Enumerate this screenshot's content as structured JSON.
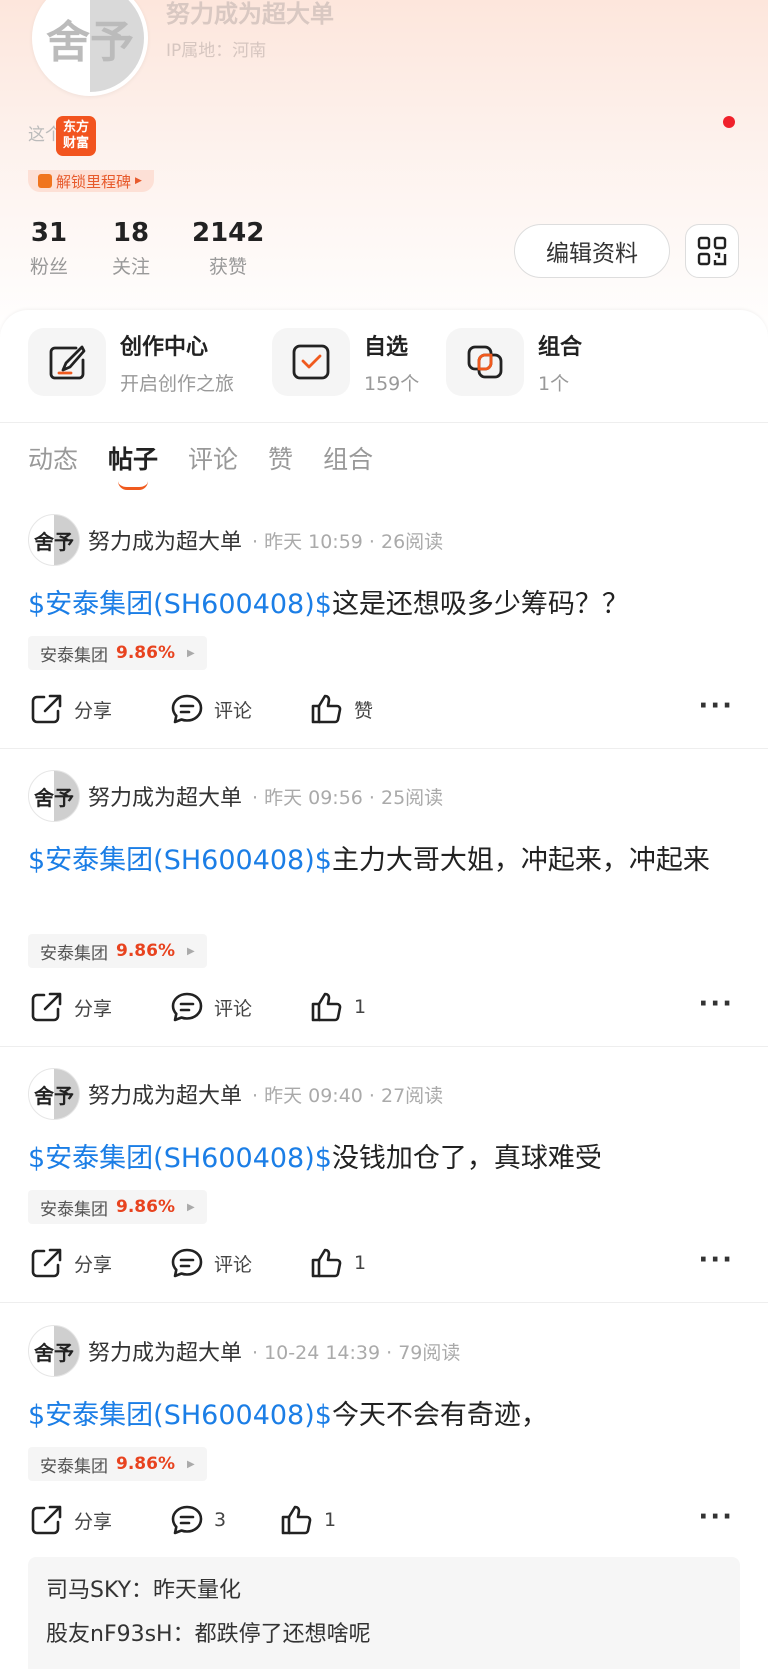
{
  "profile": {
    "avatar_text": "舍予",
    "name": "努力成为超大单",
    "ip_label": "IP属地：河南",
    "bio_prefix": "这个",
    "app_badge": "东方财富",
    "milestone": "解锁里程碑",
    "stats": [
      {
        "num": "31",
        "label": "粉丝"
      },
      {
        "num": "18",
        "label": "关注"
      },
      {
        "num": "2142",
        "label": "获赞"
      }
    ],
    "edit_button": "编辑资料"
  },
  "quick": [
    {
      "title": "创作中心",
      "sub": "开启创作之旅",
      "icon": "edit-icon"
    },
    {
      "title": "自选",
      "sub": "159个",
      "icon": "check-icon"
    },
    {
      "title": "组合",
      "sub": "1个",
      "icon": "combine-icon"
    }
  ],
  "tabs": [
    "动态",
    "帖子",
    "评论",
    "赞",
    "组合"
  ],
  "active_tab": "帖子",
  "posts": [
    {
      "avatar": "舍予",
      "name": "努力成为超大单",
      "time": "· 昨天 10:59 · 26阅读",
      "stock": "$安泰集团(SH600408)$",
      "text": "这是还想吸多少筹码？？",
      "tag_name": "安泰集团",
      "tag_pct": "9.86%",
      "share": "分享",
      "comment": "评论",
      "like": "赞"
    },
    {
      "avatar": "舍予",
      "name": "努力成为超大单",
      "time": "· 昨天 09:56 · 25阅读",
      "stock": "$安泰集团(SH600408)$",
      "text": "主力大哥大姐，冲起来，冲起来",
      "tag_name": "安泰集团",
      "tag_pct": "9.86%",
      "share": "分享",
      "comment": "评论",
      "like": "1"
    },
    {
      "avatar": "舍予",
      "name": "努力成为超大单",
      "time": "· 昨天 09:40 · 27阅读",
      "stock": "$安泰集团(SH600408)$",
      "text": "没钱加仓了，真球难受",
      "tag_name": "安泰集团",
      "tag_pct": "9.86%",
      "share": "分享",
      "comment": "评论",
      "like": "1"
    },
    {
      "avatar": "舍予",
      "name": "努力成为超大单",
      "time": "· 10-24 14:39 · 79阅读",
      "stock": "$安泰集团(SH600408)$",
      "text": "今天不会有奇迹，",
      "tag_name": "安泰集团",
      "tag_pct": "9.86%",
      "share": "分享",
      "comment": "3",
      "like": "1"
    }
  ],
  "comments": [
    {
      "user": "司马SKY：",
      "text": "昨天量化"
    },
    {
      "user": "股友nF93sH：",
      "text": "都跌停了还想啥呢"
    }
  ],
  "colors": {
    "accent": "#f05a1e",
    "link": "#1b7ee6",
    "up": "#e8431f"
  }
}
